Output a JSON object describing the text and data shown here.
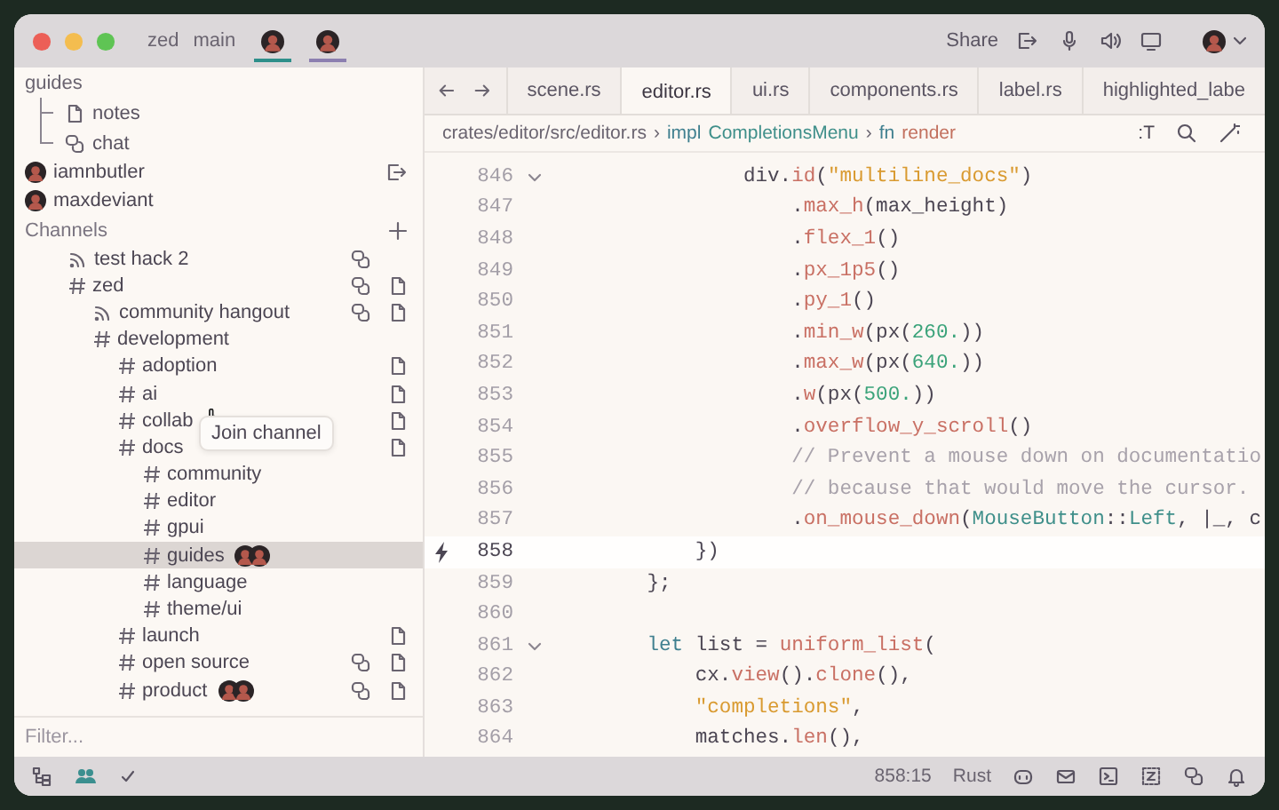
{
  "window": {
    "title_items": [
      {
        "text": "zed"
      },
      {
        "text": "main"
      }
    ],
    "collaborators": [
      {
        "color": "#2e8f8a"
      },
      {
        "color": "#8c7fb0"
      }
    ],
    "share": "Share"
  },
  "sidebar": {
    "call": {
      "channel": "guides",
      "items": [
        {
          "kind": "notes",
          "label": "notes"
        },
        {
          "kind": "chat",
          "label": "chat"
        }
      ],
      "participants": [
        {
          "name": "iamnbutler",
          "leave": true
        },
        {
          "name": "maxdeviant",
          "leave": false
        }
      ]
    },
    "channels_title": "Channels",
    "channels": [
      {
        "kind": "voice",
        "name": "test hack 2",
        "chat": true,
        "notes": false,
        "selected": false
      },
      {
        "kind": "text",
        "name": "zed",
        "chat": true,
        "notes": true,
        "selected": false,
        "children": [
          {
            "kind": "voice",
            "name": "community hangout",
            "chat": true,
            "notes": true,
            "selected": false
          },
          {
            "kind": "text",
            "name": "development",
            "chat": false,
            "notes": false,
            "selected": false,
            "children": [
              {
                "kind": "text",
                "name": "adoption",
                "chat": false,
                "notes": true,
                "selected": false
              },
              {
                "kind": "text",
                "name": "ai",
                "chat": false,
                "notes": true,
                "selected": false
              },
              {
                "kind": "text",
                "name": "collab",
                "chat": false,
                "notes": true,
                "selected": false,
                "tooltip": "Join channel"
              },
              {
                "kind": "text",
                "name": "docs",
                "chat": false,
                "notes": true,
                "selected": false,
                "children": [
                  {
                    "kind": "text",
                    "name": "community",
                    "chat": false,
                    "notes": false,
                    "selected": false
                  },
                  {
                    "kind": "text",
                    "name": "editor",
                    "chat": false,
                    "notes": false,
                    "selected": false
                  },
                  {
                    "kind": "text",
                    "name": "gpui",
                    "chat": false,
                    "notes": false,
                    "selected": false
                  },
                  {
                    "kind": "text",
                    "name": "guides",
                    "chat": false,
                    "notes": false,
                    "selected": true
                  },
                  {
                    "kind": "text",
                    "name": "language",
                    "chat": false,
                    "notes": false,
                    "selected": false
                  },
                  {
                    "kind": "text",
                    "name": "theme/ui",
                    "chat": false,
                    "notes": false,
                    "selected": false
                  }
                ]
              },
              {
                "kind": "text",
                "name": "launch",
                "chat": false,
                "notes": true,
                "selected": false
              },
              {
                "kind": "text",
                "name": "open source",
                "chat": true,
                "notes": true,
                "selected": false
              },
              {
                "kind": "text",
                "name": "product",
                "chat": true,
                "notes": true,
                "selected": false
              }
            ]
          }
        ]
      }
    ],
    "filter": {
      "placeholder": "Filter..."
    }
  },
  "tabs": [
    {
      "label": "scene.rs",
      "selected": false
    },
    {
      "label": "editor.rs",
      "selected": true
    },
    {
      "label": "ui.rs",
      "selected": false
    },
    {
      "label": "components.rs",
      "selected": false
    },
    {
      "label": "label.rs",
      "selected": false
    },
    {
      "label": "highlighted_labe",
      "selected": false
    }
  ],
  "breadcrumb": [
    {
      "text": "crates/editor/src/editor.rs",
      "kind": "path"
    },
    {
      "text": "›",
      "kind": "sep"
    },
    {
      "text": "impl",
      "kind": "keyword"
    },
    {
      "text": "CompletionsMenu",
      "kind": "type"
    },
    {
      "text": "›",
      "kind": "sep"
    },
    {
      "text": "fn",
      "kind": "keyword"
    },
    {
      "text": "render",
      "kind": "fn"
    }
  ],
  "toolbar": [
    {
      "text": ":T"
    }
  ],
  "code": [
    {
      "number": "846",
      "fold": true,
      "current": false,
      "tokens": [
        {
          "text": "                div.",
          "kind": "plain"
        },
        {
          "text": "id",
          "kind": "fn"
        },
        {
          "text": "(",
          "kind": "plain"
        },
        {
          "text": "\"multiline_docs\"",
          "kind": "str"
        },
        {
          "text": ")",
          "kind": "plain"
        }
      ]
    },
    {
      "number": "847",
      "fold": false,
      "current": false,
      "tokens": [
        {
          "text": "                    .",
          "kind": "plain"
        },
        {
          "text": "max_h",
          "kind": "fn"
        },
        {
          "text": "(max_height)",
          "kind": "plain"
        }
      ]
    },
    {
      "number": "848",
      "fold": false,
      "current": false,
      "tokens": [
        {
          "text": "                    .",
          "kind": "plain"
        },
        {
          "text": "flex_1",
          "kind": "fn"
        },
        {
          "text": "()",
          "kind": "plain"
        }
      ]
    },
    {
      "number": "849",
      "fold": false,
      "current": false,
      "tokens": [
        {
          "text": "                    .",
          "kind": "plain"
        },
        {
          "text": "px_1p5",
          "kind": "fn"
        },
        {
          "text": "()",
          "kind": "plain"
        }
      ]
    },
    {
      "number": "850",
      "fold": false,
      "current": false,
      "tokens": [
        {
          "text": "                    .",
          "kind": "plain"
        },
        {
          "text": "py_1",
          "kind": "fn"
        },
        {
          "text": "()",
          "kind": "plain"
        }
      ]
    },
    {
      "number": "851",
      "fold": false,
      "current": false,
      "tokens": [
        {
          "text": "                    .",
          "kind": "plain"
        },
        {
          "text": "min_w",
          "kind": "fn"
        },
        {
          "text": "(px(",
          "kind": "plain"
        },
        {
          "text": "260.",
          "kind": "num"
        },
        {
          "text": "))",
          "kind": "plain"
        }
      ]
    },
    {
      "number": "852",
      "fold": false,
      "current": false,
      "tokens": [
        {
          "text": "                    .",
          "kind": "plain"
        },
        {
          "text": "max_w",
          "kind": "fn"
        },
        {
          "text": "(px(",
          "kind": "plain"
        },
        {
          "text": "640.",
          "kind": "num"
        },
        {
          "text": "))",
          "kind": "plain"
        }
      ]
    },
    {
      "number": "853",
      "fold": false,
      "current": false,
      "tokens": [
        {
          "text": "                    .",
          "kind": "plain"
        },
        {
          "text": "w",
          "kind": "fn"
        },
        {
          "text": "(px(",
          "kind": "plain"
        },
        {
          "text": "500.",
          "kind": "num"
        },
        {
          "text": "))",
          "kind": "plain"
        }
      ]
    },
    {
      "number": "854",
      "fold": false,
      "current": false,
      "tokens": [
        {
          "text": "                    .",
          "kind": "plain"
        },
        {
          "text": "overflow_y_scroll",
          "kind": "fn"
        },
        {
          "text": "()",
          "kind": "plain"
        }
      ]
    },
    {
      "number": "855",
      "fold": false,
      "current": false,
      "tokens": [
        {
          "text": "                    // Prevent a mouse down on documentatio",
          "kind": "comment"
        }
      ]
    },
    {
      "number": "856",
      "fold": false,
      "current": false,
      "tokens": [
        {
          "text": "                    // because that would move the cursor.",
          "kind": "comment"
        }
      ]
    },
    {
      "number": "857",
      "fold": false,
      "current": false,
      "tokens": [
        {
          "text": "                    .",
          "kind": "plain"
        },
        {
          "text": "on_mouse_down",
          "kind": "fn"
        },
        {
          "text": "(",
          "kind": "plain"
        },
        {
          "text": "MouseButton",
          "kind": "type"
        },
        {
          "text": "::",
          "kind": "plain"
        },
        {
          "text": "Left",
          "kind": "type"
        },
        {
          "text": ", |_, c",
          "kind": "plain"
        }
      ]
    },
    {
      "number": "858",
      "fold": false,
      "current": true,
      "tokens": [
        {
          "text": "            })",
          "kind": "plain"
        }
      ]
    },
    {
      "number": "859",
      "fold": false,
      "current": false,
      "tokens": [
        {
          "text": "        };",
          "kind": "plain"
        }
      ]
    },
    {
      "number": "860",
      "fold": false,
      "current": false
    },
    {
      "number": "861",
      "fold": true,
      "current": false,
      "tokens": [
        {
          "text": "        let",
          "kind": "keyword"
        },
        {
          "text": " list = ",
          "kind": "plain"
        },
        {
          "text": "uniform_list",
          "kind": "fn"
        },
        {
          "text": "(",
          "kind": "plain"
        }
      ]
    },
    {
      "number": "862",
      "fold": false,
      "current": false,
      "tokens": [
        {
          "text": "            cx.",
          "kind": "plain"
        },
        {
          "text": "view",
          "kind": "fn"
        },
        {
          "text": "().",
          "kind": "plain"
        },
        {
          "text": "clone",
          "kind": "fn"
        },
        {
          "text": "(),",
          "kind": "plain"
        }
      ]
    },
    {
      "number": "863",
      "fold": false,
      "current": false,
      "tokens": [
        {
          "text": "            \"completions\"",
          "kind": "str"
        },
        {
          "text": ",",
          "kind": "plain"
        }
      ]
    },
    {
      "number": "864",
      "fold": false,
      "current": false,
      "tokens": [
        {
          "text": "            matches.",
          "kind": "plain"
        },
        {
          "text": "len",
          "kind": "fn"
        },
        {
          "text": "(),",
          "kind": "plain"
        }
      ]
    }
  ],
  "status_bar": {
    "position": "858:15",
    "language": "Rust"
  }
}
